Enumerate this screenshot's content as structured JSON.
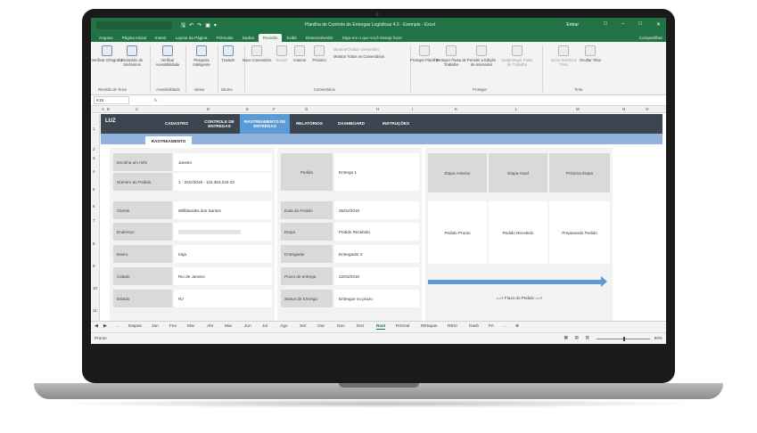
{
  "window": {
    "title": "Planilha de Controle de Entregas Logísticas 4.0 - Exemplo - Excel",
    "signin": "Entrar"
  },
  "menu": {
    "items": [
      "Arquivo",
      "Página Inicial",
      "Inserir",
      "Layout da Página",
      "Fórmulas",
      "Dados",
      "Revisão",
      "Exibir",
      "Desenvolvedor"
    ],
    "active": "Revisão",
    "tell_me": "Diga-me o que você deseja fazer",
    "share": "Compartilhar"
  },
  "ribbon": {
    "buttons": [
      "Verificar Ortografia",
      "Dicionário de Sinônimos",
      "Verificar Acessibilidade",
      "Pesquisa Inteligente",
      "Traduzir",
      "Novo Comentário",
      "Excluir",
      "Anterior",
      "Próximo",
      "Proteger Planilha",
      "Proteger Pasta de Trabalho",
      "Permitir a Edição de Intervalos",
      "Desproteger Pasta de Trabalho",
      "Iniciar Escrita à Tinta",
      "Ocultar Tinta"
    ],
    "options": [
      "Mostrar/Ocultar Comentário",
      "Mostrar Todos os Comentários"
    ],
    "groups": [
      "Revisão de Texto",
      "Acessibilidade",
      "Ideias",
      "Idioma",
      "Comentários",
      "Proteger",
      "Tinta"
    ]
  },
  "formula_bar": {
    "name_box": "K16",
    "fx": "fx",
    "value": ""
  },
  "columns": [
    "A",
    "B",
    "C",
    "D",
    "E",
    "F",
    "G",
    "H",
    "I",
    "K",
    "L",
    "M",
    "N",
    "O"
  ],
  "rows": [
    "1",
    "2",
    "3",
    "4",
    "5",
    "6",
    "7",
    "8",
    "9",
    "10",
    "11"
  ],
  "nav": {
    "logo": "LUZ",
    "items": [
      "CADASTRO",
      "CONTROLE DE ENTREGAS",
      "RASTREAMENTO DE ENTREGAS",
      "RELATÓRIOS",
      "DASHBOARD",
      "INSTRUÇÕES"
    ],
    "active": "RASTREAMENTO DE ENTREGAS",
    "subtab": "RASTREAMENTO"
  },
  "form": {
    "month_label": "Escolha um mês",
    "month_value": "Janeiro",
    "order_number_label": "Número do Pedido",
    "order_number_value": "1 - 25/2/2018 - 115.353.234-22",
    "client_label": "Cliente",
    "client_value": "Willblandes dos Santos",
    "address_label": "Endereço",
    "address_value": "",
    "district_label": "Bairro",
    "district_value": "Irajá",
    "city_label": "Cidade",
    "city_value": "Rio de Janeiro",
    "state_label": "Estado",
    "state_value": "RJ",
    "order_label": "Pedido",
    "order_value": "Entrega 1",
    "order_date_label": "Data do Pedido",
    "order_date_value": "25/02/2018",
    "stage_label": "Etapa",
    "stage_value": "Pedido Recebido",
    "courier_label": "Entregador",
    "courier_value": "Entregador 2",
    "deadline_label": "Prazo de entrega",
    "deadline_value": "22/03/2018",
    "status_label": "Status de Entrega",
    "status_value": "Entregue no prazo"
  },
  "tracking": {
    "prev_label": "Etapa Anterior",
    "current_label": "Etapa Atual",
    "next_label": "Próxima Etapa",
    "prev_value": "Pedido Pronto",
    "current_value": "Pedido Recebido",
    "next_value": "Preparando Pedido",
    "flow_label": "==> Fluxo do Pedido ==>"
  },
  "sheet_tabs": {
    "items": [
      "...",
      "Etapas",
      "Jan",
      "Fev",
      "Mar",
      "Abr",
      "Mai",
      "Jun",
      "Jul",
      "Ago",
      "Set",
      "Out",
      "Nov",
      "Dez",
      "Rast",
      "RGeral",
      "REtapas",
      "REnt",
      "Dash",
      "PA",
      "..."
    ],
    "active": "Rast"
  },
  "status_bar": {
    "ready": "Pronto",
    "zoom": "90%"
  }
}
